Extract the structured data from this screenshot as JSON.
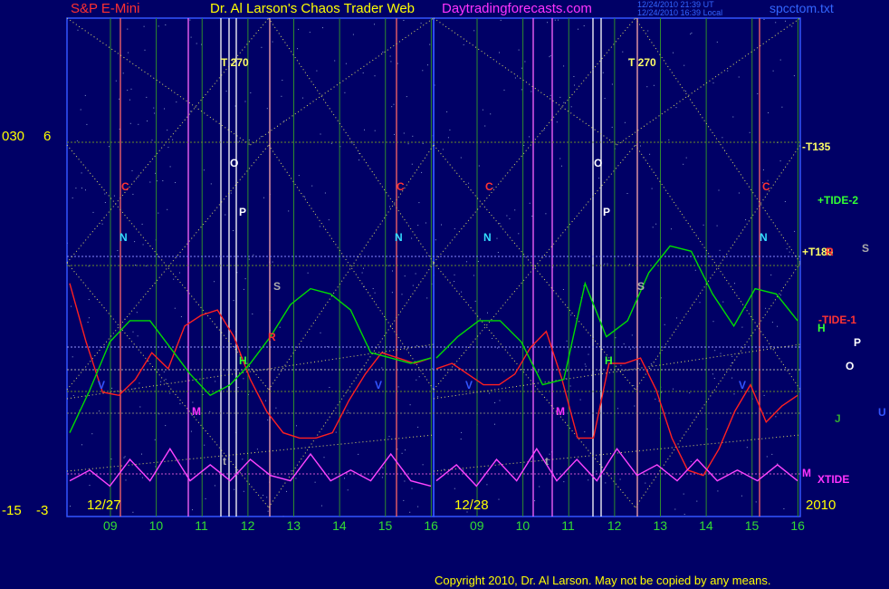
{
  "header": {
    "instrument": "S&P E-Mini",
    "title": "Dr. Al Larson's Chaos Trader Web",
    "site": "Daytradingforecasts.com",
    "timestamp_ut": "12/24/2010 21:39 UT",
    "timestamp_local": "12/24/2010 16:39 Local",
    "file": "spcctom.txt"
  },
  "axes": {
    "left_top_a": "030",
    "left_top_b": "6",
    "left_bottom_a": "-15",
    "left_bottom_b": "-3",
    "date_left": "12/27",
    "date_mid": "12/28",
    "year": "2010",
    "hours_left": [
      "09",
      "10",
      "11",
      "12",
      "13",
      "14",
      "15",
      "16"
    ],
    "hours_right": [
      "09",
      "10",
      "11",
      "12",
      "13",
      "14",
      "15",
      "16"
    ]
  },
  "labels": {
    "t270": "T 270",
    "minus_t135": "-T135",
    "plus_tide2": "+TIDE-2",
    "plus_t180": "+T180",
    "minus_tide1": "-TIDE-1",
    "xtide": "XTIDE"
  },
  "planet_marks": [
    "C",
    "N",
    "O",
    "P",
    "S",
    "R",
    "H",
    "V",
    "M",
    "J",
    "U",
    "t"
  ],
  "copyright": "Copyright 2010, Dr. Al Larson. May not be copied by any means.",
  "colors": {
    "background": "#000066",
    "frame": "#3355ff",
    "red_line": "#ff2020",
    "green_line": "#00dd00",
    "magenta_line": "#ff44ff",
    "grid_green": "#2e8b2e",
    "dotted_yellow": "#dddd66",
    "header_red": "#ff3030",
    "header_yellow": "#ffff00",
    "header_magenta": "#ff33ff",
    "header_blue": "#3366ff"
  },
  "chart_data": {
    "type": "line",
    "title": "S&P E-Mini",
    "days": [
      "12/27",
      "12/28"
    ],
    "hours": [
      "09",
      "10",
      "11",
      "12",
      "13",
      "14",
      "15",
      "16"
    ],
    "series": [
      {
        "name": "",
        "color": "red",
        "values_day1": [
          6,
          0.5,
          -4.2,
          -4.5,
          -3.0,
          -0.5,
          -2.0,
          2.0,
          3.0,
          3.5,
          1.0,
          -3.0,
          -6.0,
          -8.0,
          -8.5,
          -8.5,
          -8.0,
          -5.0,
          -2.5,
          -0.5,
          -1.0,
          -1.5,
          -1.0
        ],
        "values_day2": [
          -2.0,
          -1.5,
          -2.5,
          -3.5,
          -3.5,
          -2.5,
          0,
          1.5,
          -3.0,
          -8.5,
          -8.5,
          -1.5,
          -1.5,
          -1.0,
          -4.0,
          -8.5,
          -11.5,
          -12.0,
          -9.5,
          -6.0,
          -3.5,
          -7.0,
          -5.5,
          -4.5
        ]
      },
      {
        "name": "",
        "color": "green",
        "values_day1": [
          -8.0,
          -4.0,
          0.5,
          2.5,
          2.5,
          0,
          -2.5,
          -4.5,
          -3.5,
          -1.5,
          1.0,
          4.0,
          5.5,
          5.0,
          3.5,
          -0.5,
          -1.0,
          -1.5,
          -1.0
        ],
        "values_day2": [
          -1.0,
          1.0,
          2.5,
          2.5,
          0.5,
          -3.5,
          -3.0,
          6.0,
          1.0,
          2.5,
          7.0,
          9.5,
          9.0,
          5.0,
          2.0,
          5.5,
          5.0,
          2.5
        ]
      },
      {
        "name": "XTIDE",
        "color": "magenta",
        "values_day1": [
          -12.5,
          -11.5,
          -13.0,
          -10.5,
          -12.5,
          -9.5,
          -12.5,
          -11.0,
          -12.5,
          -10.5,
          -12.0,
          -12.5,
          -10.0,
          -12.5,
          -11.5,
          -12.5,
          -10.0,
          -12.5,
          -13.0
        ],
        "values_day2": [
          -12.5,
          -11.0,
          -13.0,
          -10.5,
          -12.5,
          -9.5,
          -12.5,
          -10.5,
          -12.5,
          -9.5,
          -12.0,
          -11.0,
          -12.5,
          -10.5,
          -12.5,
          -11.5,
          -12.5,
          -11.0,
          -12.5
        ]
      }
    ],
    "ylim": [
      -15,
      30
    ],
    "grid": true,
    "legend": "right"
  }
}
